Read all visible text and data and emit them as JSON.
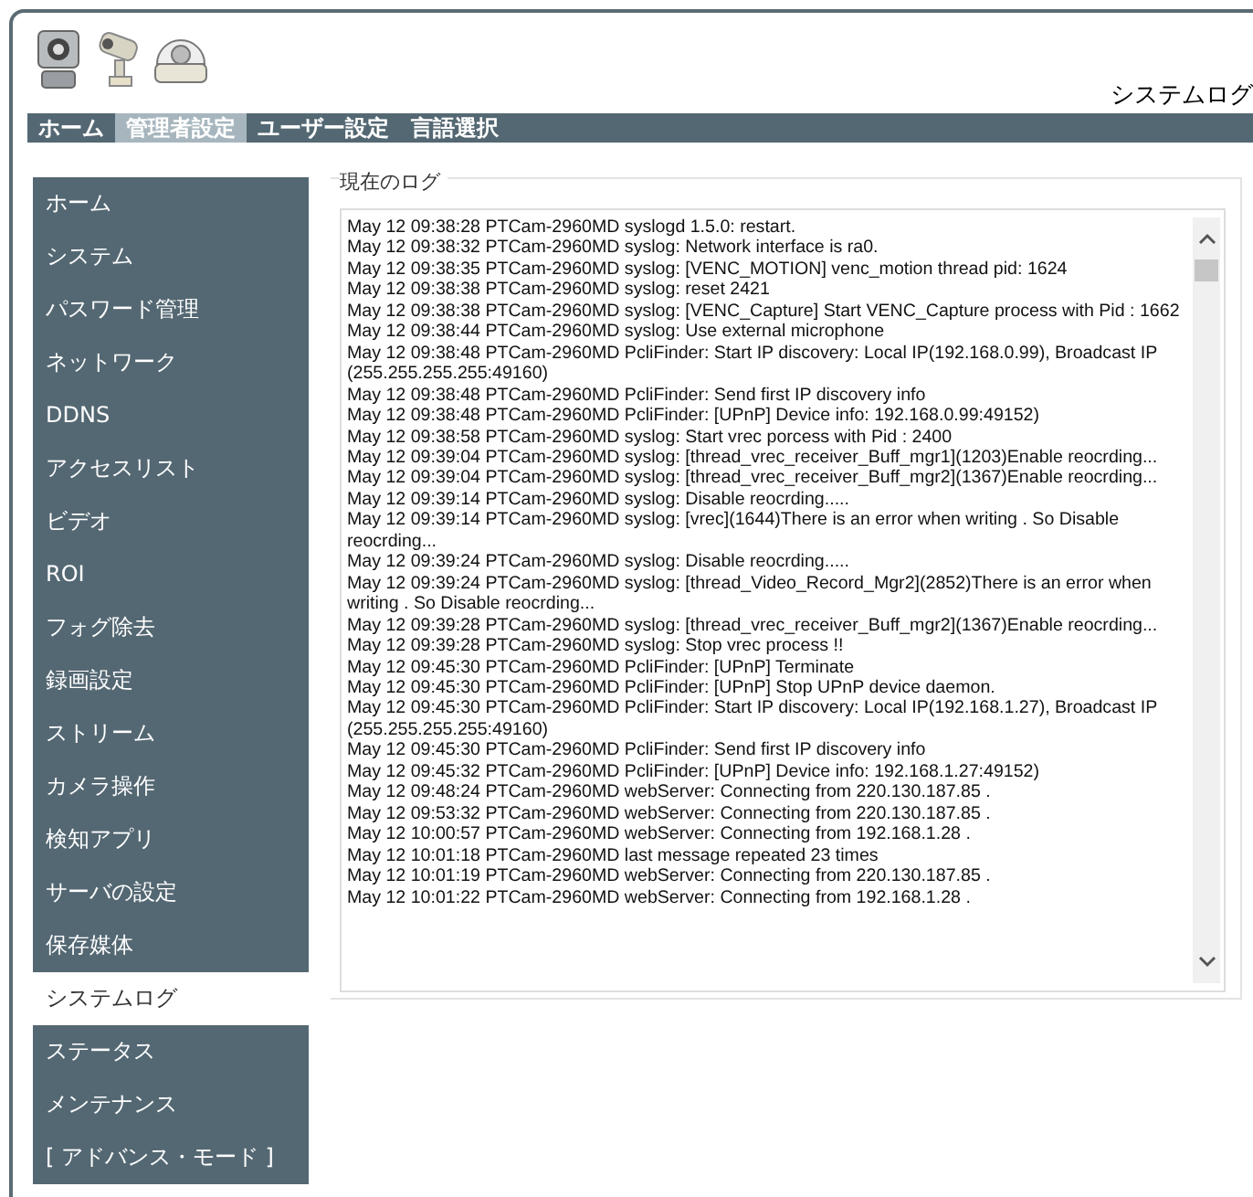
{
  "page_title": "システムログ",
  "nav_tabs": [
    {
      "label": "ホーム",
      "selected": false
    },
    {
      "label": "管理者設定",
      "selected": true
    },
    {
      "label": "ユーザー設定",
      "selected": false
    },
    {
      "label": "言語選択",
      "selected": false
    }
  ],
  "sidebar": {
    "items": [
      {
        "label": "ホーム",
        "selected": false
      },
      {
        "label": "システム",
        "selected": false
      },
      {
        "label": "パスワード管理",
        "selected": false
      },
      {
        "label": "ネットワーク",
        "selected": false
      },
      {
        "label": "DDNS",
        "selected": false
      },
      {
        "label": "アクセスリスト",
        "selected": false
      },
      {
        "label": "ビデオ",
        "selected": false
      },
      {
        "label": "ROI",
        "selected": false
      },
      {
        "label": "フォグ除去",
        "selected": false
      },
      {
        "label": "録画設定",
        "selected": false
      },
      {
        "label": "ストリーム",
        "selected": false
      },
      {
        "label": "カメラ操作",
        "selected": false
      },
      {
        "label": "検知アプリ",
        "selected": false
      },
      {
        "label": "サーバの設定",
        "selected": false
      },
      {
        "label": "保存媒体",
        "selected": false
      },
      {
        "label": "システムログ",
        "selected": true
      },
      {
        "label": "ステータス",
        "selected": false
      },
      {
        "label": "メンテナンス",
        "selected": false
      },
      {
        "label": "[ アドバンス・モード ]",
        "selected": false
      }
    ]
  },
  "log_panel": {
    "legend": "現在のログ",
    "lines": [
      "May 12 09:38:28 PTCam-2960MD syslogd 1.5.0: restart.",
      "May 12 09:38:32 PTCam-2960MD syslog: Network interface is ra0.",
      "May 12 09:38:35 PTCam-2960MD syslog: [VENC_MOTION] venc_motion thread pid: 1624",
      "May 12 09:38:38 PTCam-2960MD syslog: reset 2421",
      "May 12 09:38:38 PTCam-2960MD syslog: [VENC_Capture] Start VENC_Capture process with Pid : 1662",
      "May 12 09:38:44 PTCam-2960MD syslog: Use external microphone",
      "May 12 09:38:48 PTCam-2960MD PcliFinder: Start IP discovery: Local IP(192.168.0.99), Broadcast IP (255.255.255.255:49160)",
      "May 12 09:38:48 PTCam-2960MD PcliFinder: Send first IP discovery info",
      "May 12 09:38:48 PTCam-2960MD PcliFinder: [UPnP] Device info: 192.168.0.99:49152)",
      "May 12 09:38:58 PTCam-2960MD syslog: Start vrec porcess with Pid : 2400",
      "May 12 09:39:04 PTCam-2960MD syslog: [thread_vrec_receiver_Buff_mgr1](1203)Enable reocrding...",
      "May 12 09:39:04 PTCam-2960MD syslog: [thread_vrec_receiver_Buff_mgr2](1367)Enable reocrding...",
      "May 12 09:39:14 PTCam-2960MD syslog: Disable reocrding.....",
      "May 12 09:39:14 PTCam-2960MD syslog: [vrec](1644)There is an error when writing . So Disable reocrding...",
      "May 12 09:39:24 PTCam-2960MD syslog: Disable reocrding.....",
      "May 12 09:39:24 PTCam-2960MD syslog: [thread_Video_Record_Mgr2](2852)There is an error when writing . So Disable reocrding...",
      "May 12 09:39:28 PTCam-2960MD syslog: [thread_vrec_receiver_Buff_mgr2](1367)Enable reocrding...",
      "May 12 09:39:28 PTCam-2960MD syslog: Stop vrec process !!",
      "May 12 09:45:30 PTCam-2960MD PcliFinder: [UPnP] Terminate",
      "May 12 09:45:30 PTCam-2960MD PcliFinder: [UPnP] Stop UPnP device daemon.",
      "May 12 09:45:30 PTCam-2960MD PcliFinder: Start IP discovery: Local IP(192.168.1.27), Broadcast IP (255.255.255.255:49160)",
      "May 12 09:45:30 PTCam-2960MD PcliFinder: Send first IP discovery info",
      "May 12 09:45:32 PTCam-2960MD PcliFinder: [UPnP] Device info: 192.168.1.27:49152)",
      "May 12 09:48:24 PTCam-2960MD webServer: Connecting from 220.130.187.85 .",
      "May 12 09:53:32 PTCam-2960MD webServer: Connecting from 220.130.187.85 .",
      "May 12 10:00:57 PTCam-2960MD webServer: Connecting from 192.168.1.28 .",
      "May 12 10:01:18 PTCam-2960MD last message repeated 23 times",
      "May 12 10:01:19 PTCam-2960MD webServer: Connecting from 220.130.187.85 .",
      "May 12 10:01:22 PTCam-2960MD webServer: Connecting from 192.168.1.28 ."
    ]
  }
}
